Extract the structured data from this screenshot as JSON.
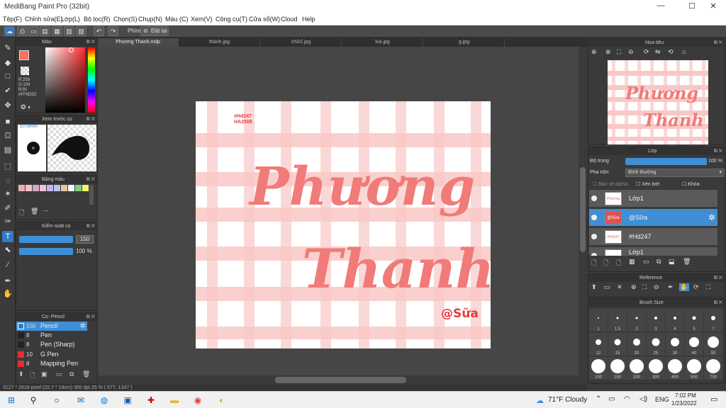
{
  "window": {
    "title": "MediBang Paint Pro (32bit)",
    "minimize": "—",
    "maximize": "☐",
    "close": "✕"
  },
  "menu": [
    "Tệp(F)",
    "Chỉnh sửa(E)",
    "Lớp(L)",
    "Bộ lọc(R)",
    "Chọn(S)",
    "Chụp(N)",
    "Màu (C)",
    "Xem(V)",
    "Công cụ(T)",
    "Cửa sổ(W)",
    "Cloud",
    "Help"
  ],
  "toolbar": {
    "shortcut_label": "Phím",
    "reset_label": "Đặt lại"
  },
  "tabs": [
    "Phương Thanh.mdp",
    "thành.jpg",
    "chữ2.jpg",
    "kìa.jpg",
    "g.jpg"
  ],
  "color_panel": {
    "title": "Màu",
    "r": "R:255",
    "g": "G:109",
    "b": "B:92",
    "hex": "#FF6D5C",
    "fg": "#ff6d5c"
  },
  "preview_panel": {
    "title": "Xem trước cọ",
    "size": "10.09mm"
  },
  "palette_panel": {
    "title": "Bảng màu",
    "swatches": [
      "#e8b3b3",
      "#f3c6c6",
      "#d7a7c7",
      "#f2c2d6",
      "#c9b3e6",
      "#b5c8f0",
      "#f0c3a0",
      "#f7f7f7",
      "#7cd37c",
      "#f7f173"
    ],
    "separator": "---"
  },
  "control_panel": {
    "title": "Kiểm soát cọ",
    "size": "150",
    "opacity": "100 %"
  },
  "brush_panel": {
    "title": "Cọ: Pencil",
    "brushes": [
      {
        "size": "150",
        "name": "Pencil",
        "color": "#2f7bc6"
      },
      {
        "size": "8",
        "name": "Pen",
        "color": "#222222"
      },
      {
        "size": "8",
        "name": "Pen (Sharp)",
        "color": "#222222"
      },
      {
        "size": "10",
        "name": "G Pen",
        "color": "#e03030"
      },
      {
        "size": "8",
        "name": "Mapping Pen",
        "color": "#e03030"
      }
    ]
  },
  "artwork": {
    "tag1": "#Hd247",
    "tag2": "HA2508",
    "word1": "Phương",
    "word2": "Thanh",
    "sign": "@Sữa"
  },
  "status": "3127 * 2618 pixel   (22.7 * 19cm)   350 dpi   25 %   ( 677, 1347 )",
  "navigator": {
    "title": "Hoa tiêu"
  },
  "layer_panel": {
    "title": "Lớp",
    "opacity_label": "Độ trong",
    "opacity_value": "100 %",
    "blend_label": "Pha trộn",
    "blend_value": "Bình thường",
    "protect_alpha": "Bảo vệ alpha",
    "clipping": "Xén bớt",
    "lock": "Khóa",
    "layers": [
      {
        "name": "Lớp1",
        "thumb": "Phương",
        "selected": false
      },
      {
        "name": "@Sữa",
        "thumb": "@Sữa",
        "selected": true
      },
      {
        "name": "#Hd247",
        "thumb": "#Hd247",
        "selected": false
      },
      {
        "name": "Lớp1",
        "thumb": "",
        "selected": false
      }
    ]
  },
  "reference_panel": {
    "title": "Reference"
  },
  "brush_size_panel": {
    "title": "Brush Size",
    "sizes": [
      "1",
      "1.5",
      "2",
      "3",
      "4",
      "5",
      "7",
      "12",
      "15",
      "20",
      "25",
      "30",
      "40",
      "50",
      "100",
      "150",
      "200",
      "300",
      "400",
      "500",
      "700"
    ]
  },
  "taskbar": {
    "weather": "71°F  Cloudy",
    "lang": "ENG",
    "time": "7:02 PM",
    "date": "1/23/2022"
  }
}
